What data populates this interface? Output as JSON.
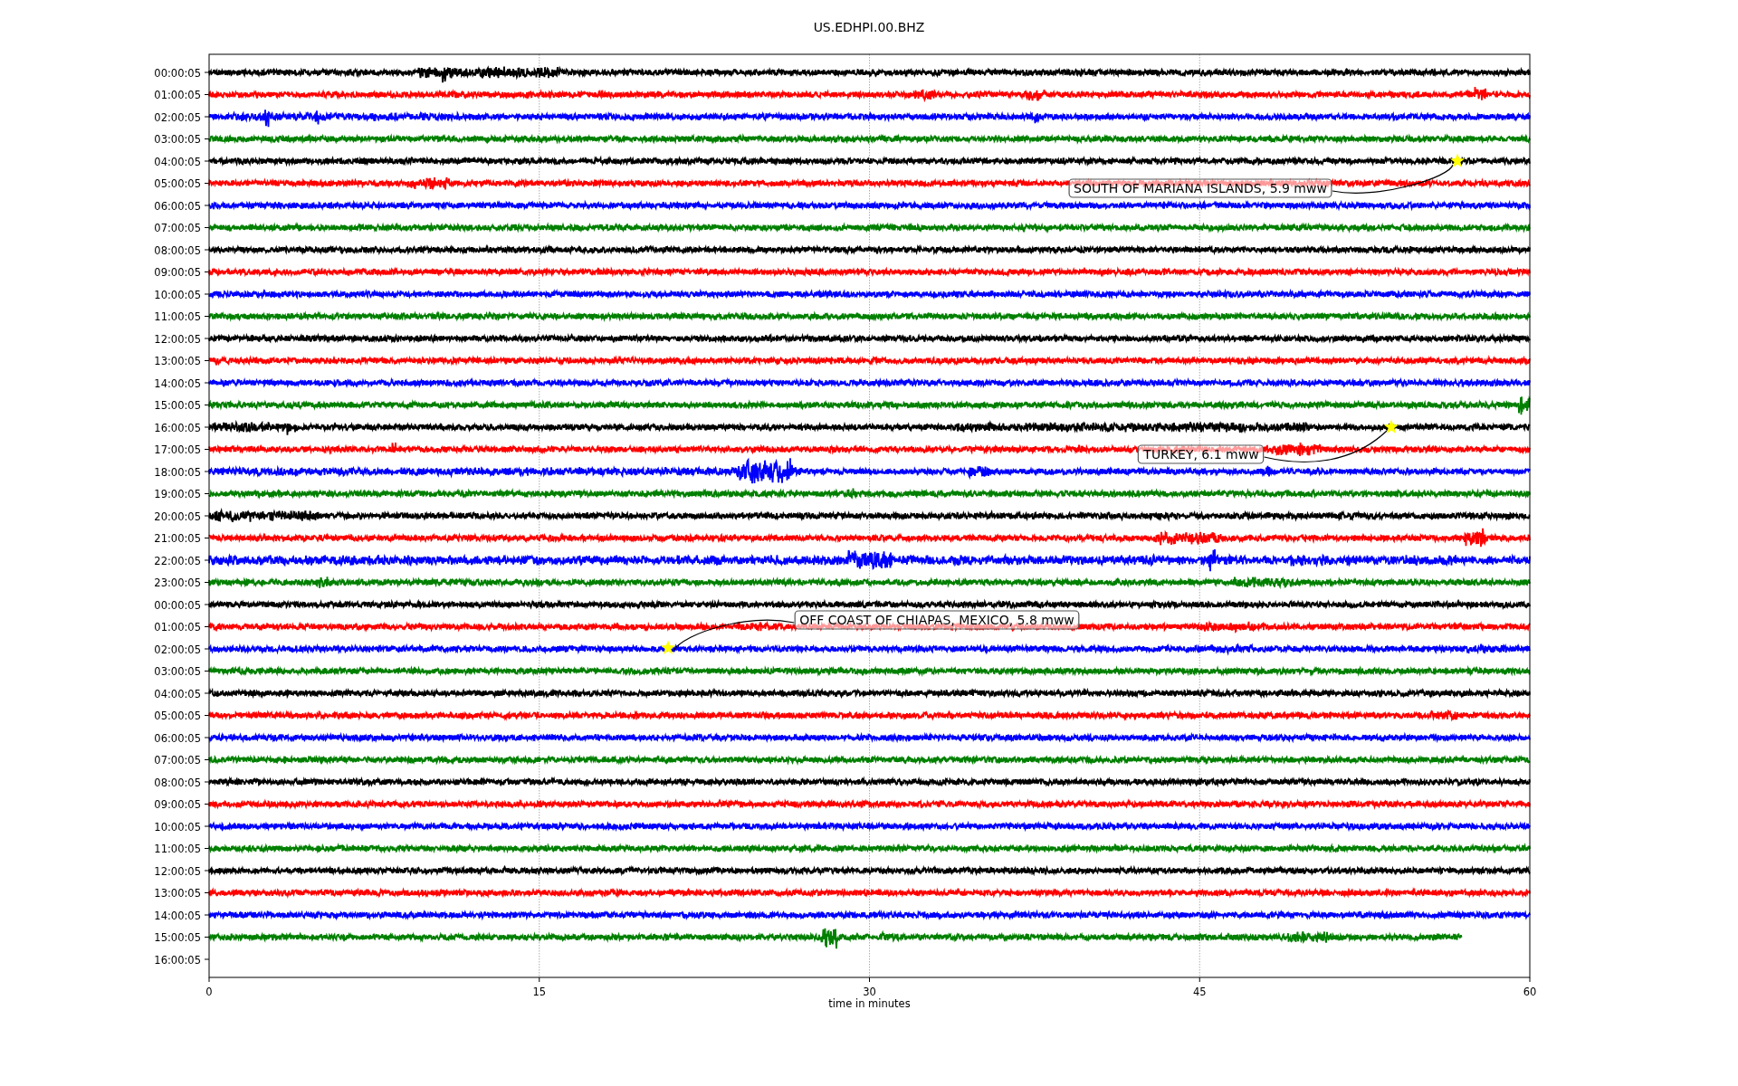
{
  "title": "US.EDHPI.00.BHZ",
  "rows": [
    {
      "label": "00:00:05",
      "color": "#000000"
    },
    {
      "label": "01:00:05",
      "color": "#ff0000"
    },
    {
      "label": "02:00:05",
      "color": "#0000ff"
    },
    {
      "label": "03:00:05",
      "color": "#008000"
    },
    {
      "label": "04:00:05",
      "color": "#000000"
    },
    {
      "label": "05:00:05",
      "color": "#ff0000"
    },
    {
      "label": "06:00:05",
      "color": "#0000ff"
    },
    {
      "label": "07:00:05",
      "color": "#008000"
    },
    {
      "label": "08:00:05",
      "color": "#000000"
    },
    {
      "label": "09:00:05",
      "color": "#ff0000"
    },
    {
      "label": "10:00:05",
      "color": "#0000ff"
    },
    {
      "label": "11:00:05",
      "color": "#008000"
    },
    {
      "label": "12:00:05",
      "color": "#000000"
    },
    {
      "label": "13:00:05",
      "color": "#ff0000"
    },
    {
      "label": "14:00:05",
      "color": "#0000ff"
    },
    {
      "label": "15:00:05",
      "color": "#008000"
    },
    {
      "label": "16:00:05",
      "color": "#000000"
    },
    {
      "label": "17:00:05",
      "color": "#ff0000"
    },
    {
      "label": "18:00:05",
      "color": "#0000ff"
    },
    {
      "label": "19:00:05",
      "color": "#008000"
    },
    {
      "label": "20:00:05",
      "color": "#000000"
    },
    {
      "label": "21:00:05",
      "color": "#ff0000"
    },
    {
      "label": "22:00:05",
      "color": "#0000ff"
    },
    {
      "label": "23:00:05",
      "color": "#008000"
    },
    {
      "label": "00:00:05",
      "color": "#000000"
    },
    {
      "label": "01:00:05",
      "color": "#ff0000"
    },
    {
      "label": "02:00:05",
      "color": "#0000ff"
    },
    {
      "label": "03:00:05",
      "color": "#008000"
    },
    {
      "label": "04:00:05",
      "color": "#000000"
    },
    {
      "label": "05:00:05",
      "color": "#ff0000"
    },
    {
      "label": "06:00:05",
      "color": "#0000ff"
    },
    {
      "label": "07:00:05",
      "color": "#008000"
    },
    {
      "label": "08:00:05",
      "color": "#000000"
    },
    {
      "label": "09:00:05",
      "color": "#ff0000"
    },
    {
      "label": "10:00:05",
      "color": "#0000ff"
    },
    {
      "label": "11:00:05",
      "color": "#008000"
    },
    {
      "label": "12:00:05",
      "color": "#000000"
    },
    {
      "label": "13:00:05",
      "color": "#ff0000"
    },
    {
      "label": "14:00:05",
      "color": "#0000ff"
    },
    {
      "label": "15:00:05",
      "color": "#008000"
    },
    {
      "label": "16:00:05"
    }
  ],
  "x_ticks": [
    "0",
    "15",
    "30",
    "45",
    "60"
  ],
  "x_label": "time in minutes",
  "events": [
    {
      "label": "SOUTH OF MARIANA ISLANDS, 5.9 mww"
    },
    {
      "label": "TURKEY, 6.1 mww"
    },
    {
      "label": "OFF COAST OF CHIAPAS, MEXICO, 5.8 mww"
    }
  ]
}
